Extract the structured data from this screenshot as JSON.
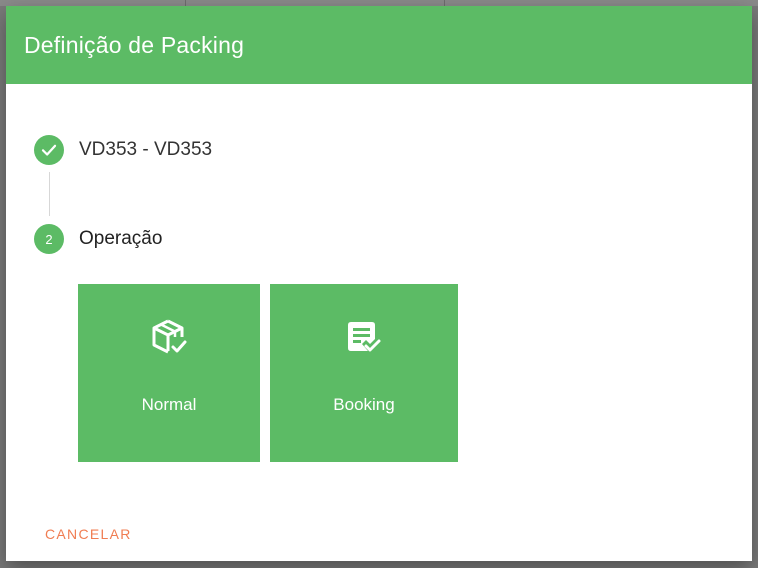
{
  "dialog": {
    "title": "Definição de Packing"
  },
  "stepper": {
    "steps": [
      {
        "status": "completed",
        "icon": "check-icon",
        "label": "VD353 - VD353"
      },
      {
        "status": "active",
        "number": "2",
        "label": "Operação"
      }
    ]
  },
  "operations": [
    {
      "label": "Normal",
      "icon": "package-check-icon"
    },
    {
      "label": "Booking",
      "icon": "document-check-icon"
    }
  ],
  "actions": {
    "cancel_label": "CANCELAR"
  },
  "colors": {
    "primary": "#5cbb65",
    "accent": "#f07d52",
    "text": "#333333"
  }
}
